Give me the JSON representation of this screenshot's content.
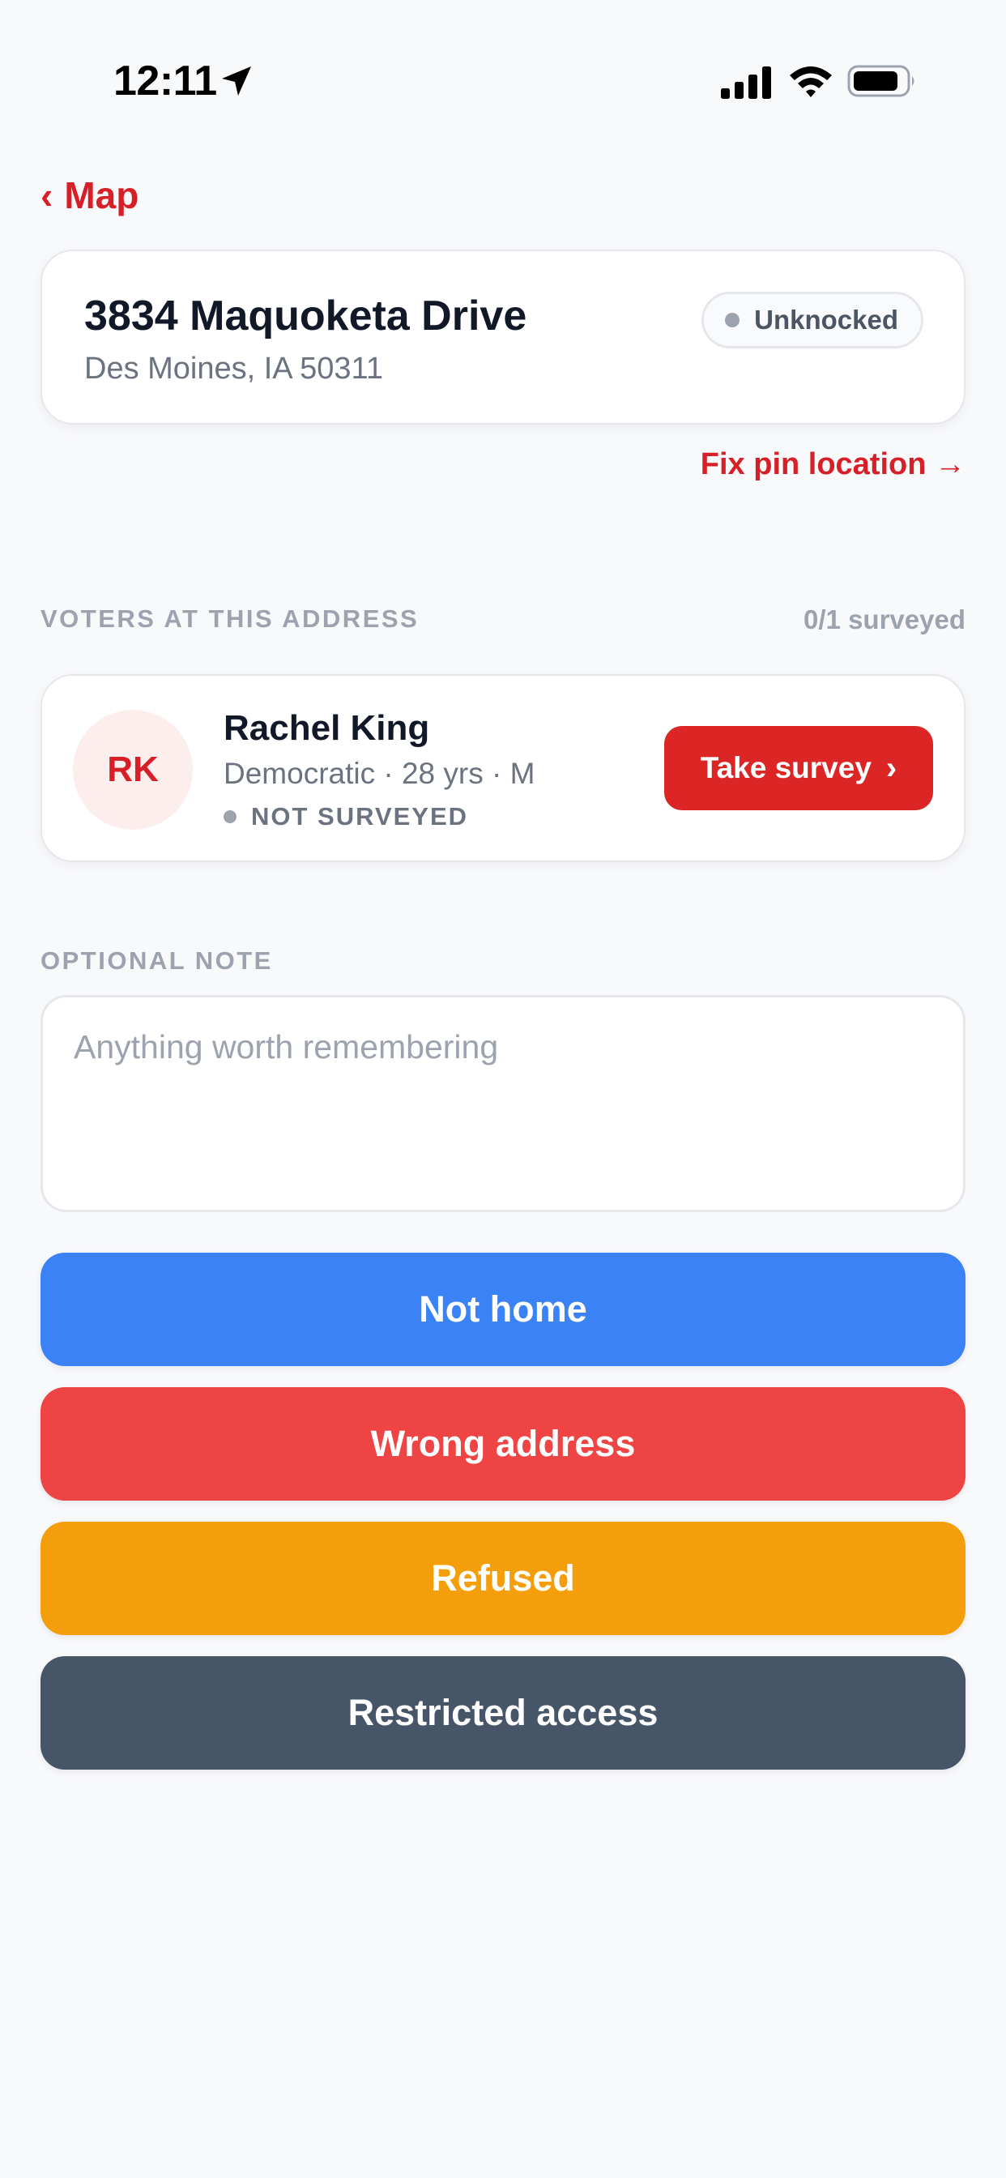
{
  "status_bar": {
    "time": "12:11",
    "icons": [
      "location-arrow-icon",
      "cellular-signal-icon",
      "wifi-icon",
      "battery-icon"
    ]
  },
  "nav": {
    "back_label": "Map",
    "back_chevron": "‹"
  },
  "address": {
    "street": "3834 Maquoketa Drive",
    "city_line": "Des Moines, IA 50311",
    "status_badge": "Unknocked",
    "fix_pin_label": "Fix pin location →"
  },
  "voters_section": {
    "header": "VOTERS AT THIS ADDRESS",
    "surveyed_count": "0/1 surveyed",
    "voters": [
      {
        "initials": "RK",
        "name": "Rachel King",
        "meta": "Democratic · 28 yrs · M",
        "status": "NOT SURVEYED",
        "action_label": "Take survey",
        "action_chevron": "›"
      }
    ]
  },
  "note_section": {
    "header": "OPTIONAL NOTE",
    "placeholder": "Anything worth remembering",
    "value": ""
  },
  "outcomes": [
    {
      "label": "Not home",
      "color": "#3b82f6"
    },
    {
      "label": "Wrong address",
      "color": "#ef4444"
    },
    {
      "label": "Refused",
      "color": "#f59e0b"
    },
    {
      "label": "Restricted access",
      "color": "#475569"
    }
  ],
  "colors": {
    "accent": "#d61f26",
    "background": "#f8f9fb",
    "muted_text": "#9ca3af"
  }
}
